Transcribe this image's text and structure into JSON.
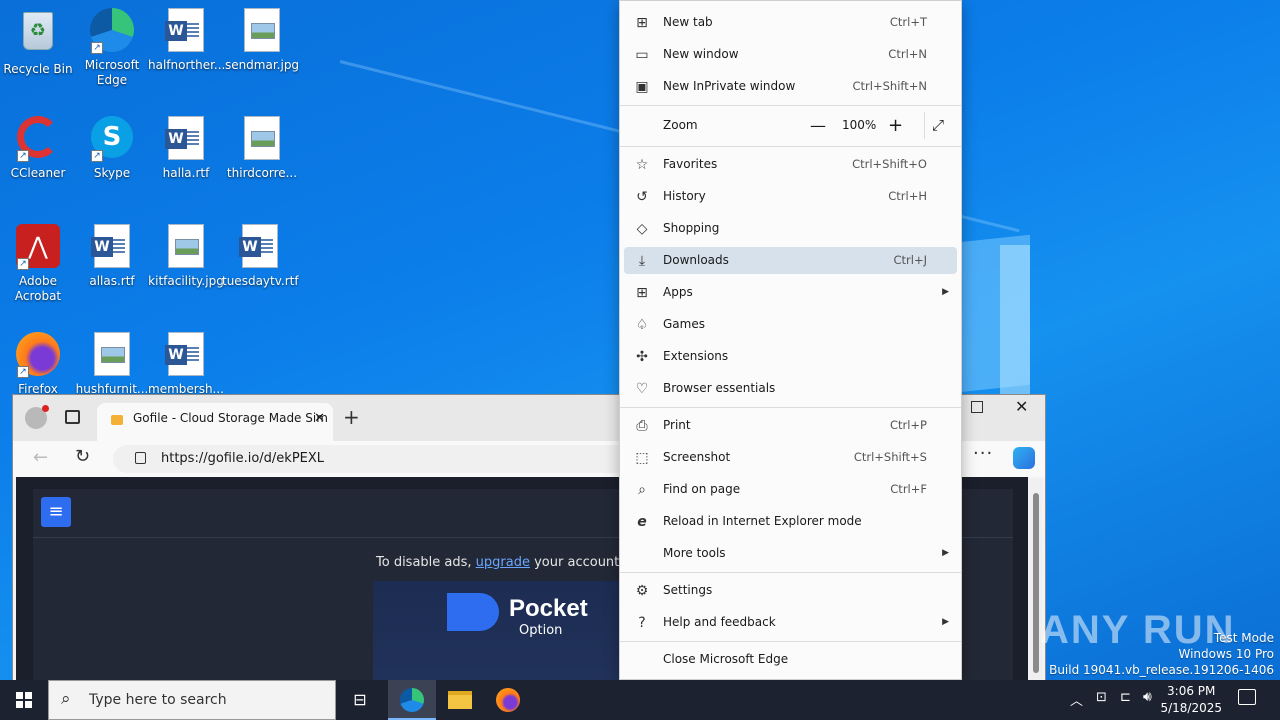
{
  "desktop": {
    "icons": [
      {
        "label": "Recycle Bin"
      },
      {
        "label": "Microsoft Edge"
      },
      {
        "label": "halfnorther..."
      },
      {
        "label": "sendmar.jpg"
      },
      {
        "label": "CCleaner"
      },
      {
        "label": "Skype"
      },
      {
        "label": "halla.rtf"
      },
      {
        "label": "thirdcorre..."
      },
      {
        "label": "Adobe Acrobat"
      },
      {
        "label": "allas.rtf"
      },
      {
        "label": "kitfacility.jpg"
      },
      {
        "label": "tuesdaytv.rtf"
      },
      {
        "label": "Firefox"
      },
      {
        "label": "hushfurnit..."
      },
      {
        "label": "membersh..."
      }
    ]
  },
  "browser": {
    "tab_title": "Gofile - Cloud Storage Made Sim",
    "url": "https://gofile.io/d/ekPEXL",
    "ad_text": "To disable ads, ",
    "ad_link": "upgrade",
    "ad_text_after": " your account to",
    "ad_brand": "Pocket",
    "ad_brand_sub": "Option"
  },
  "menu": {
    "items": [
      {
        "label": "New tab",
        "shortcut": "Ctrl+T",
        "icon": "new-tab-icon"
      },
      {
        "label": "New window",
        "shortcut": "Ctrl+N",
        "icon": "new-window-icon"
      },
      {
        "label": "New InPrivate window",
        "shortcut": "Ctrl+Shift+N",
        "icon": "inprivate-icon"
      },
      {
        "label": "Zoom",
        "zoom_value": "100%"
      },
      {
        "label": "Favorites",
        "shortcut": "Ctrl+Shift+O",
        "icon": "favorites-icon"
      },
      {
        "label": "History",
        "shortcut": "Ctrl+H",
        "icon": "history-icon"
      },
      {
        "label": "Shopping",
        "shortcut": "",
        "icon": "shopping-tag-icon"
      },
      {
        "label": "Downloads",
        "shortcut": "Ctrl+J",
        "icon": "download-icon"
      },
      {
        "label": "Apps",
        "shortcut": "",
        "icon": "apps-icon"
      },
      {
        "label": "Games",
        "shortcut": "",
        "icon": "games-icon"
      },
      {
        "label": "Extensions",
        "shortcut": "",
        "icon": "extensions-icon"
      },
      {
        "label": "Browser essentials",
        "shortcut": "",
        "icon": "heart-pulse-icon"
      },
      {
        "label": "Print",
        "shortcut": "Ctrl+P",
        "icon": "print-icon"
      },
      {
        "label": "Screenshot",
        "shortcut": "Ctrl+Shift+S",
        "icon": "screenshot-icon"
      },
      {
        "label": "Find on page",
        "shortcut": "Ctrl+F",
        "icon": "find-icon"
      },
      {
        "label": "Reload in Internet Explorer mode",
        "shortcut": "",
        "icon": "ie-icon"
      },
      {
        "label": "More tools",
        "shortcut": "",
        "icon": ""
      },
      {
        "label": "Settings",
        "shortcut": "",
        "icon": "gear-icon"
      },
      {
        "label": "Help and feedback",
        "shortcut": "",
        "icon": "help-icon"
      },
      {
        "label": "Close Microsoft Edge",
        "shortcut": "",
        "icon": ""
      }
    ]
  },
  "taskbar": {
    "search_placeholder": "Type here to search",
    "time": "3:06 PM",
    "date": "5/18/2025"
  },
  "watermark": {
    "line1": "Test Mode",
    "line2": "Windows 10 Pro",
    "line3": "Build 19041.vb_release.191206-1406",
    "brand": "ANY RUN"
  }
}
